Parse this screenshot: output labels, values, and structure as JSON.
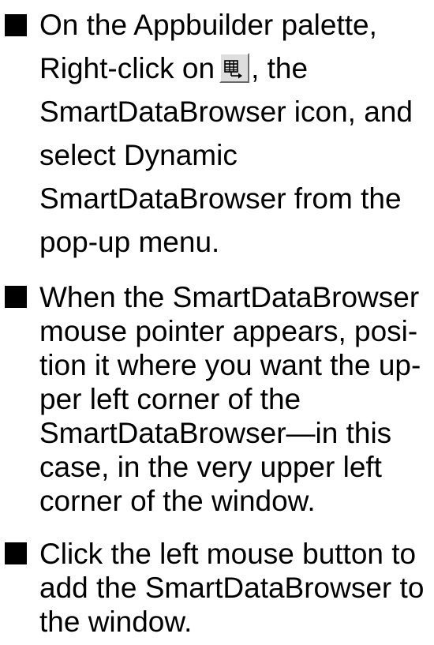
{
  "steps": [
    {
      "lines": [
        "On the Appbuilder palette,",
        "Right-click on",
        ", the",
        "SmartDataBrowser icon, and",
        "select Dynamic",
        "SmartDataBrowser from the",
        "pop-up menu."
      ]
    },
    {
      "lines": [
        "When the SmartDataBrowser",
        "mouse pointer appears, posi-",
        "tion it where you want the up-",
        "per left corner of the",
        "SmartDataBrowser—in this",
        "case, in the very upper left",
        "corner of the window."
      ]
    },
    {
      "lines": [
        "Click the left mouse button to",
        "add the SmartDataBrowser to",
        "the window."
      ]
    }
  ],
  "icons": {
    "palette_icon": "smartdatabrowser-palette-icon",
    "bullet": "filled-square"
  }
}
